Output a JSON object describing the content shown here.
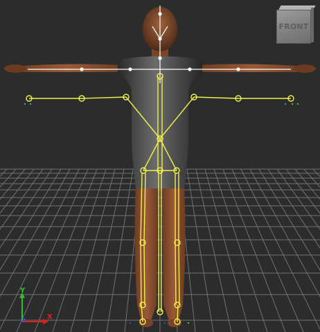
{
  "viewport": {
    "view_cube_label": "FRONT",
    "axes": {
      "x_label": "X",
      "y_label": "Y"
    },
    "colors": {
      "background": "#2c2c2c",
      "grid": "#8a8a8a",
      "rig": "#f2f24a",
      "upper_bones": "#ffffff",
      "axis_x": "#e02020",
      "axis_y": "#30c030",
      "axis_z": "#3050ff"
    }
  }
}
